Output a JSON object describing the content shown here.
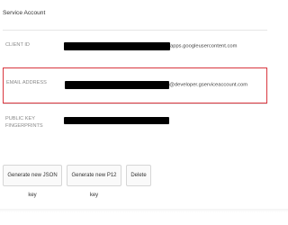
{
  "section": {
    "title": "Service Account"
  },
  "rows": [
    {
      "label": "CLIENT ID",
      "value_suffix": "apps.googleusercontent.com"
    },
    {
      "label": "EMAIL ADDRESS",
      "value_suffix": "@developer.gserviceaccount.com"
    },
    {
      "label_line1": "PUBLIC KEY",
      "label_line2": "FINGERPRINTS"
    }
  ],
  "buttons": {
    "json_key": "Generate new JSON key",
    "p12_key": "Generate new P12 key",
    "delete": "Delete"
  },
  "colors": {
    "highlight_border": "#d9363e",
    "redaction": "#000000",
    "label_text": "#8a8a8a"
  }
}
